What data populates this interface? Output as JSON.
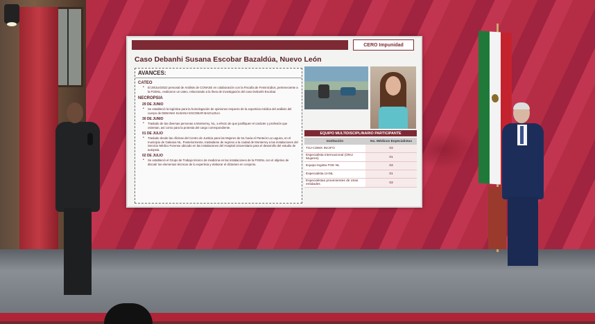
{
  "slide": {
    "logo_text": "CERO Impunidad",
    "title": "Caso Debanhi Susana Escobar Bazaldúa, Nuevo León",
    "avances_label": "AVANCES:",
    "sections": [
      {
        "label": "CATEO",
        "entries": [
          {
            "date": "",
            "text": "El 29/Jun/2022 personal de Análisis de CONASE en colaboración con la Fiscalía de Feminicidios, perteneciente a la FGENL, realizaron un cateo, relacionado a la línea de investigación del caso Debanhi Escobar."
          }
        ]
      },
      {
        "label": "NECROPSIA",
        "entries": [
          {
            "date": "29 DE JUNIO",
            "text": "Se estableció la logística para la homologación de opiniones respecto de la experticia médica del análisis del cuerpo de DEBANHI SUSANA ESCOBAR BAZALDUA."
          },
          {
            "date": "30 DE JUNIO",
            "text": "Traslado de las diversas personas a Monterrey, NL, a efecto de que justifiquen el carácter y profesión que ostentan, así como para la protesta del cargo correspondiente."
          },
          {
            "date": "01 DE JULIO",
            "text": "Traslado desde las oficinas del Centro de Justicia para las Mujeres de NL hacia el Panteón La Laguna, en el municipio de Galeana NL. Posteriormente, trasladarse de regreso a la ciudad de Monterrey a las instalaciones del Servicio Médico Forense ubicado en las instalaciones del Hospital Universitario para el desarrollo del estudio de autopsia."
          },
          {
            "date": "02 DE JULIO",
            "text": "Se estableció el Grupo de Trabajo técnico de medicina en las instalaciones de la FGENL con el objetivo de discutir los elementos técnicos de lo experticia y elaborar el dictamen en conjunto."
          }
        ]
      }
    ],
    "team_heading": "EQUIPO MULTIDISCIPLINARIO PARTICIPANTE",
    "team_table": {
      "headers": [
        "Institución",
        "No. Médicos Especialistas"
      ],
      "rows": [
        [
          "TSJ-CDMX INCIFO",
          "03"
        ],
        [
          "Especialista Internacional (ONU Mujeres)",
          "01"
        ],
        [
          "Equipo legista FGE NL",
          "03"
        ],
        [
          "Especialista UANL",
          "01"
        ],
        [
          "Especialistas provenientes de otras entidades",
          "03"
        ]
      ]
    }
  }
}
